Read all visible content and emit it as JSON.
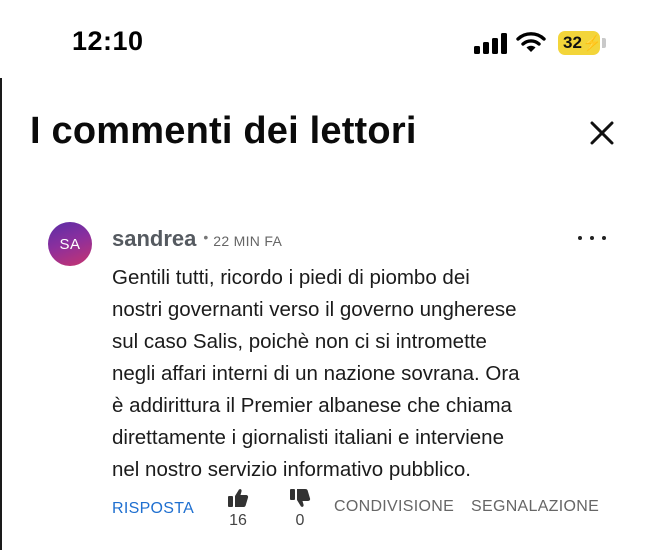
{
  "status_bar": {
    "time": "12:10",
    "battery": "32",
    "battery_color": "#f3d53a"
  },
  "header": {
    "title": "I commenti dei lettori",
    "close_icon": "close-icon"
  },
  "comment": {
    "avatar_initials": "SA",
    "author": "sandrea",
    "separator": "•",
    "time_ago": "22 MIN FA",
    "more_icon": "more-options-icon",
    "text": "Gentili tutti, ricordo i piedi di piombo dei\nnostri governanti verso il governo ungherese\nsul caso Salis, poichè non ci si intromette\nnegli affari interni di un nazione sovrana. Ora\nè addirittura il Premier albanese che chiama\ndirettamente i giornalisti italiani e interviene\nnel nostro servizio informativo pubblico.",
    "actions": {
      "reply_label": "RISPOSTA",
      "likes": "16",
      "dislikes": "0",
      "share_label": "CONDIVISIONE",
      "report_label": "SEGNALAZIONE"
    }
  },
  "colors": {
    "accent": "#1e6fd0",
    "avatar_gradient_start": "#5b2ea6",
    "avatar_gradient_end": "#c7346f"
  }
}
